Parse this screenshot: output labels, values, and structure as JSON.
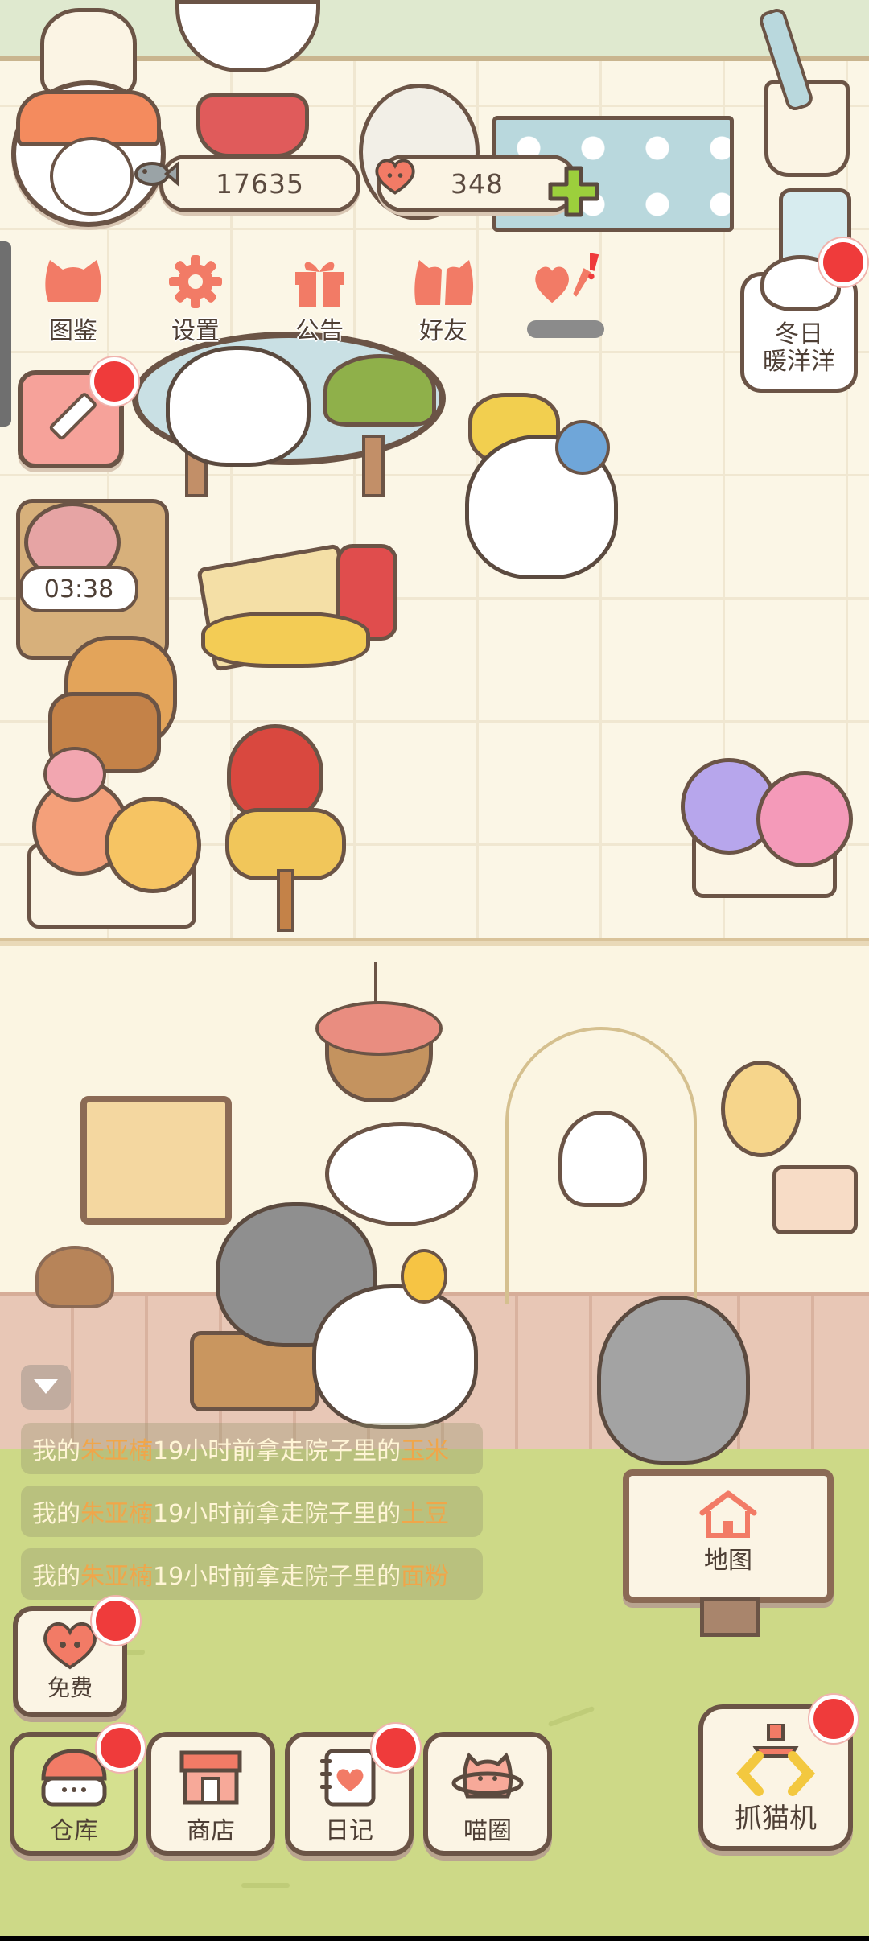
{
  "currency": {
    "fish_amount": "17635",
    "heart_amount": "348"
  },
  "top_menu": [
    {
      "label": "图鉴",
      "icon": "cat-face-icon"
    },
    {
      "label": "设置",
      "icon": "gear-icon"
    },
    {
      "label": "公告",
      "icon": "gift-icon"
    },
    {
      "label": "好友",
      "icon": "friends-icon"
    },
    {
      "label": "",
      "icon": "heart-exclaim-icon"
    }
  ],
  "event": {
    "label": "冬日\n暖洋洋"
  },
  "timer": "03:38",
  "activity_log": [
    {
      "prefix": "我的",
      "name": "朱亚楠",
      "text": "19小时前拿走院子里的",
      "item": "玉米"
    },
    {
      "prefix": "我的",
      "name": "朱亚楠",
      "text": "19小时前拿走院子里的",
      "item": "土豆"
    },
    {
      "prefix": "我的",
      "name": "朱亚楠",
      "text": "19小时前拿走院子里的",
      "item": "面粉"
    }
  ],
  "map_label": "地图",
  "free_label": "免费",
  "bottom_nav": [
    {
      "label": "仓库",
      "icon": "warehouse-icon",
      "badge": true
    },
    {
      "label": "商店",
      "icon": "shop-icon",
      "badge": false
    },
    {
      "label": "日记",
      "icon": "diary-icon",
      "badge": true
    },
    {
      "label": "喵圈",
      "icon": "cat-planet-icon",
      "badge": false
    }
  ],
  "claw_label": "抓猫机",
  "colors": {
    "outline": "#6b5446",
    "badge_red": "#ef3b3b",
    "accent_coral": "#f27b66",
    "yard_green": "#cdd987",
    "log_name_color": "#f0a64a",
    "log_item_color": "#f0a64a"
  }
}
